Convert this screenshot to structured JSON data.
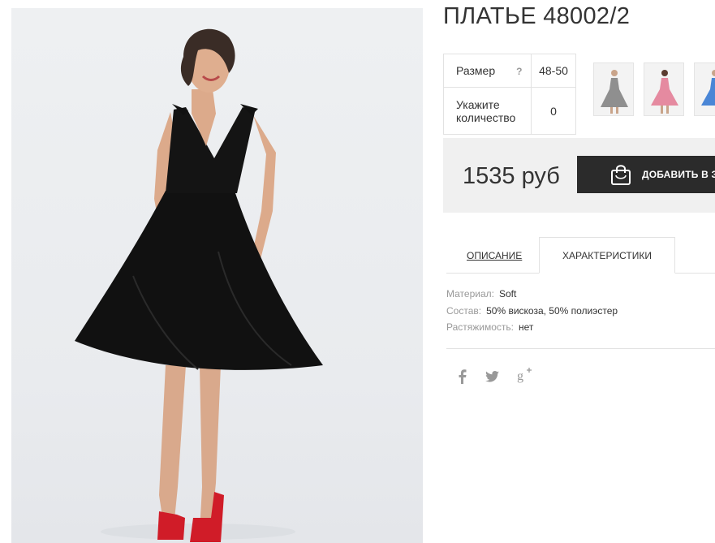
{
  "product": {
    "title": "ПЛАТЬЕ 48002/2",
    "image_alt": "Model in black sleeveless midi dress with bow straps and red sandals"
  },
  "options": {
    "size_label": "Размер",
    "size_help": "?",
    "size_value": "48-50",
    "qty_label_line1": "Укажите",
    "qty_label_line2": "количество",
    "qty_value": "0"
  },
  "thumbnails": [
    {
      "name": "grey-dress",
      "color": "#9a9a9a"
    },
    {
      "name": "pink-dress",
      "color": "#e58aa0"
    },
    {
      "name": "blue-dress",
      "color": "#4a86d6"
    }
  ],
  "purchase": {
    "price": "1535 руб",
    "add_to_cart": "ДОБАВИТЬ В З"
  },
  "tabs": {
    "description": "ОПИСАНИЕ",
    "characteristics": "ХАРАКТЕРИСТИКИ"
  },
  "specs": [
    {
      "key": "Материал:",
      "value": "Soft"
    },
    {
      "key": "Состав:",
      "value": "50% вискоза, 50% полиэстер"
    },
    {
      "key": "Растяжимость:",
      "value": "нет"
    }
  ],
  "social": [
    {
      "icon": "facebook-icon",
      "glyph": "f"
    },
    {
      "icon": "twitter-icon",
      "glyph": "twitter"
    },
    {
      "icon": "google-plus-icon",
      "glyph": "g+"
    }
  ]
}
